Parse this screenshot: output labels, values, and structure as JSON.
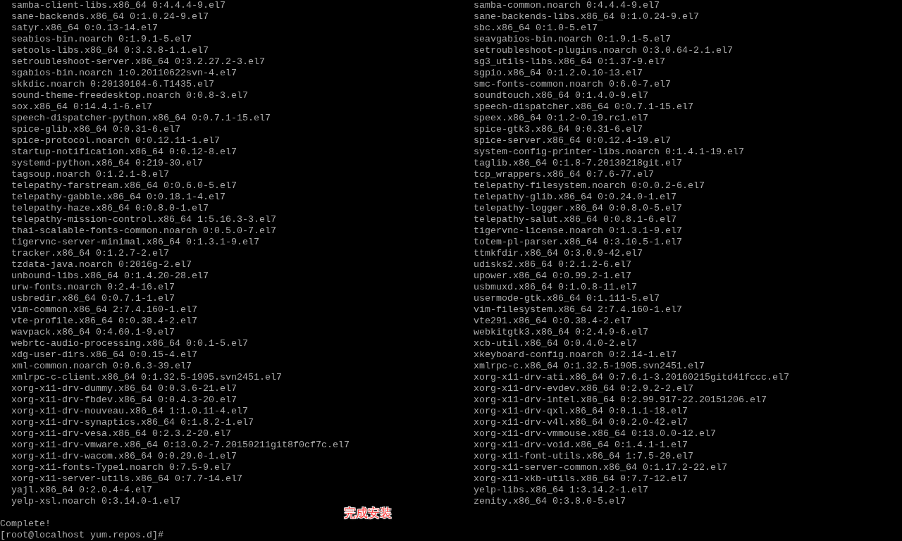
{
  "terminal": {
    "left_column": [
      "samba-client-libs.x86_64 0:4.4.4-9.el7",
      "sane-backends.x86_64 0:1.0.24-9.el7",
      "satyr.x86_64 0:0.13-14.el7",
      "seabios-bin.noarch 0:1.9.1-5.el7",
      "setools-libs.x86_64 0:3.3.8-1.1.el7",
      "setroubleshoot-server.x86_64 0:3.2.27.2-3.el7",
      "sgabios-bin.noarch 1:0.20110622svn-4.el7",
      "skkdic.noarch 0:20130104-6.T1435.el7",
      "sound-theme-freedesktop.noarch 0:0.8-3.el7",
      "sox.x86_64 0:14.4.1-6.el7",
      "speech-dispatcher-python.x86_64 0:0.7.1-15.el7",
      "spice-glib.x86_64 0:0.31-6.el7",
      "spice-protocol.noarch 0:0.12.11-1.el7",
      "startup-notification.x86_64 0:0.12-8.el7",
      "systemd-python.x86_64 0:219-30.el7",
      "tagsoup.noarch 0:1.2.1-8.el7",
      "telepathy-farstream.x86_64 0:0.6.0-5.el7",
      "telepathy-gabble.x86_64 0:0.18.1-4.el7",
      "telepathy-haze.x86_64 0:0.8.0-1.el7",
      "telepathy-mission-control.x86_64 1:5.16.3-3.el7",
      "thai-scalable-fonts-common.noarch 0:0.5.0-7.el7",
      "tigervnc-server-minimal.x86_64 0:1.3.1-9.el7",
      "tracker.x86_64 0:1.2.7-2.el7",
      "tzdata-java.noarch 0:2016g-2.el7",
      "unbound-libs.x86_64 0:1.4.20-28.el7",
      "urw-fonts.noarch 0:2.4-16.el7",
      "usbredir.x86_64 0:0.7.1-1.el7",
      "vim-common.x86_64 2:7.4.160-1.el7",
      "vte-profile.x86_64 0:0.38.4-2.el7",
      "wavpack.x86_64 0:4.60.1-9.el7",
      "webrtc-audio-processing.x86_64 0:0.1-5.el7",
      "xdg-user-dirs.x86_64 0:0.15-4.el7",
      "xml-common.noarch 0:0.6.3-39.el7",
      "xmlrpc-c-client.x86_64 0:1.32.5-1905.svn2451.el7",
      "xorg-x11-drv-dummy.x86_64 0:0.3.6-21.el7",
      "xorg-x11-drv-fbdev.x86_64 0:0.4.3-20.el7",
      "xorg-x11-drv-nouveau.x86_64 1:1.0.11-4.el7",
      "xorg-x11-drv-synaptics.x86_64 0:1.8.2-1.el7",
      "xorg-x11-drv-vesa.x86_64 0:2.3.2-20.el7",
      "xorg-x11-drv-vmware.x86_64 0:13.0.2-7.20150211git8f0cf7c.el7",
      "xorg-x11-drv-wacom.x86_64 0:0.29.0-1.el7",
      "xorg-x11-fonts-Type1.noarch 0:7.5-9.el7",
      "xorg-x11-server-utils.x86_64 0:7.7-14.el7",
      "yajl.x86_64 0:2.0.4-4.el7",
      "yelp-xsl.noarch 0:3.14.0-1.el7"
    ],
    "right_column": [
      "samba-common.noarch 0:4.4.4-9.el7",
      "sane-backends-libs.x86_64 0:1.0.24-9.el7",
      "sbc.x86_64 0:1.0-5.el7",
      "seavgabios-bin.noarch 0:1.9.1-5.el7",
      "setroubleshoot-plugins.noarch 0:3.0.64-2.1.el7",
      "sg3_utils-libs.x86_64 0:1.37-9.el7",
      "sgpio.x86_64 0:1.2.0.10-13.el7",
      "smc-fonts-common.noarch 0:6.0-7.el7",
      "soundtouch.x86_64 0:1.4.0-9.el7",
      "speech-dispatcher.x86_64 0:0.7.1-15.el7",
      "speex.x86_64 0:1.2-0.19.rc1.el7",
      "spice-gtk3.x86_64 0:0.31-6.el7",
      "spice-server.x86_64 0:0.12.4-19.el7",
      "system-config-printer-libs.noarch 0:1.4.1-19.el7",
      "taglib.x86_64 0:1.8-7.20130218git.el7",
      "tcp_wrappers.x86_64 0:7.6-77.el7",
      "telepathy-filesystem.noarch 0:0.0.2-6.el7",
      "telepathy-glib.x86_64 0:0.24.0-1.el7",
      "telepathy-logger.x86_64 0:0.8.0-5.el7",
      "telepathy-salut.x86_64 0:0.8.1-6.el7",
      "tigervnc-license.noarch 0:1.3.1-9.el7",
      "totem-pl-parser.x86_64 0:3.10.5-1.el7",
      "ttmkfdir.x86_64 0:3.0.9-42.el7",
      "udisks2.x86_64 0:2.1.2-6.el7",
      "upower.x86_64 0:0.99.2-1.el7",
      "usbmuxd.x86_64 0:1.0.8-11.el7",
      "usermode-gtk.x86_64 0:1.111-5.el7",
      "vim-filesystem.x86_64 2:7.4.160-1.el7",
      "vte291.x86_64 0:0.38.4-2.el7",
      "webkitgtk3.x86_64 0:2.4.9-6.el7",
      "xcb-util.x86_64 0:0.4.0-2.el7",
      "xkeyboard-config.noarch 0:2.14-1.el7",
      "xmlrpc-c.x86_64 0:1.32.5-1905.svn2451.el7",
      "xorg-x11-drv-ati.x86_64 0:7.6.1-3.20160215gitd41fccc.el7",
      "xorg-x11-drv-evdev.x86_64 0:2.9.2-2.el7",
      "xorg-x11-drv-intel.x86_64 0:2.99.917-22.20151206.el7",
      "xorg-x11-drv-qxl.x86_64 0:0.1.1-18.el7",
      "xorg-x11-drv-v4l.x86_64 0:0.2.0-42.el7",
      "xorg-x11-drv-vmmouse.x86_64 0:13.0.0-12.el7",
      "xorg-x11-drv-void.x86_64 0:1.4.1-1.el7",
      "xorg-x11-font-utils.x86_64 1:7.5-20.el7",
      "xorg-x11-server-common.x86_64 0:1.17.2-22.el7",
      "xorg-x11-xkb-utils.x86_64 0:7.7-12.el7",
      "yelp-libs.x86_64 1:3.14.2-1.el7",
      "zenity.x86_64 0:3.8.0-5.el7"
    ],
    "status_line": "Complete!",
    "prompt": "[root@localhost yum.repos.d]#"
  },
  "annotation": "完成安装"
}
